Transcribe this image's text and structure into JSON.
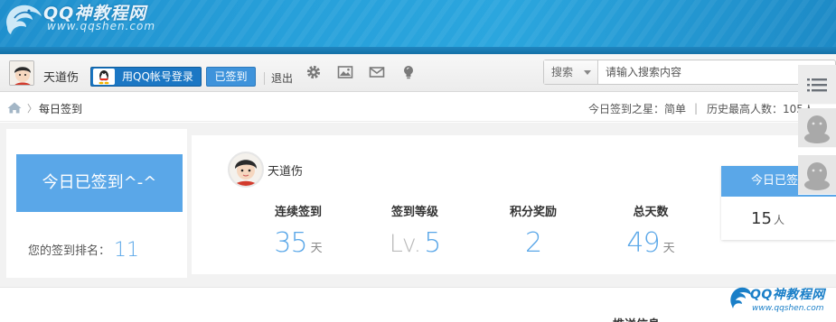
{
  "site": {
    "logo_title": "QQ神教程网",
    "logo_url": "www.qqshen.com"
  },
  "toolbar": {
    "username": "天道伤",
    "qq_login_label": "用QQ帐号登录",
    "signed_label": "已签到",
    "logout_label": "退出",
    "icons": [
      "gear-icon",
      "image-icon",
      "mail-icon",
      "lightbulb-icon"
    ]
  },
  "search": {
    "category": "搜索",
    "placeholder": "请输入搜索内容"
  },
  "breadcrumb": {
    "current": "每日签到",
    "star_label": "今日签到之星：",
    "star_name": "简单",
    "divider": "|",
    "highest_label": "历史最高人数：",
    "highest_value": "105",
    "highest_suffix": "人"
  },
  "signin": {
    "status": "今日已签到^-^",
    "rank_label": "您的签到排名：",
    "rank_value": "11"
  },
  "profile": {
    "name": "天道伤"
  },
  "stats": [
    {
      "label": "连续签到",
      "value": "35",
      "unit": "天"
    },
    {
      "label": "签到等级",
      "prefix": "Lv.",
      "value": "5",
      "unit": ""
    },
    {
      "label": "积分奖励",
      "value": "2",
      "unit": ""
    },
    {
      "label": "总天数",
      "value": "49",
      "unit": "天"
    }
  ],
  "today": {
    "label": "今日已签到",
    "value": "15",
    "unit": "人"
  },
  "bottom": {
    "cut_heading": "推送信息"
  },
  "watermark": {
    "title": "QQ神教程网",
    "url": "www.qqshen.com"
  },
  "colors": {
    "accent": "#5aa7e8",
    "banner": "#27a0da",
    "qq_button": "#1b77c4"
  }
}
